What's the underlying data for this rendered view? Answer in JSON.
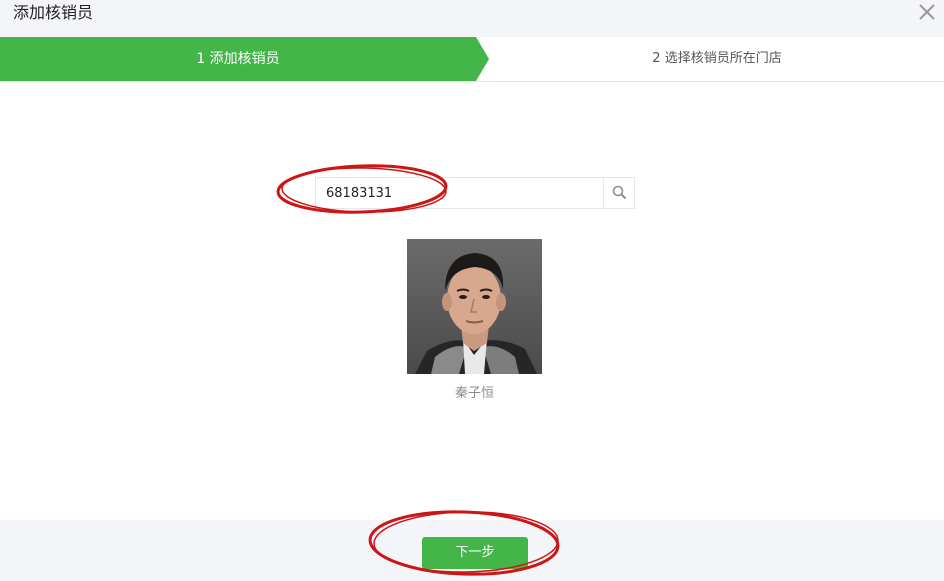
{
  "dialog": {
    "title": "添加核销员",
    "close_icon": "close-icon"
  },
  "stepper": {
    "accent_color": "#44b549",
    "steps": [
      {
        "label": "1 添加核销员",
        "state": "active"
      },
      {
        "label": "2 选择核销员所在门店",
        "state": "inactive"
      }
    ]
  },
  "search": {
    "value": "68183131",
    "placeholder": "",
    "icon": "search-icon"
  },
  "result": {
    "name": "秦子恒",
    "avatar_icon": "avatar"
  },
  "footer": {
    "next_label": "下一步"
  },
  "annotation_color": "#cc1616"
}
